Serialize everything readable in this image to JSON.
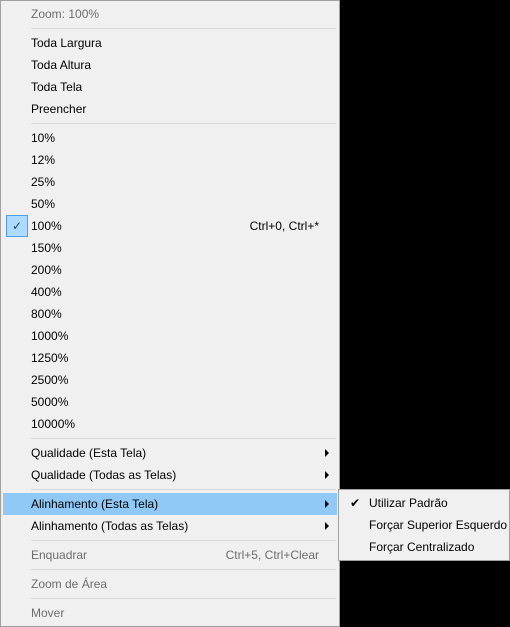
{
  "mainMenu": {
    "header": "Zoom: 100%",
    "fit": {
      "width": "Toda Largura",
      "height": "Toda Altura",
      "screen": "Toda Tela",
      "fill": "Preencher"
    },
    "zoom": {
      "p10": "10%",
      "p12": "12%",
      "p25": "25%",
      "p50": "50%",
      "p100": "100%",
      "p100_shortcut": "Ctrl+0, Ctrl+*",
      "p150": "150%",
      "p200": "200%",
      "p400": "400%",
      "p800": "800%",
      "p1000": "1000%",
      "p1250": "1250%",
      "p2500": "2500%",
      "p5000": "5000%",
      "p10000": "10000%"
    },
    "quality": {
      "this": "Qualidade (Esta Tela)",
      "all": "Qualidade (Todas as Telas)"
    },
    "align": {
      "this": "Alinhamento (Esta Tela)",
      "all": "Alinhamento (Todas as Telas)"
    },
    "frame": "Enquadrar",
    "frame_shortcut": "Ctrl+5, Ctrl+Clear",
    "areaZoom": "Zoom de Área",
    "move": "Mover"
  },
  "subMenu": {
    "default": "Utilizar Padrão",
    "topLeft": "Forçar Superior Esquerdo",
    "center": "Forçar Centralizado"
  }
}
